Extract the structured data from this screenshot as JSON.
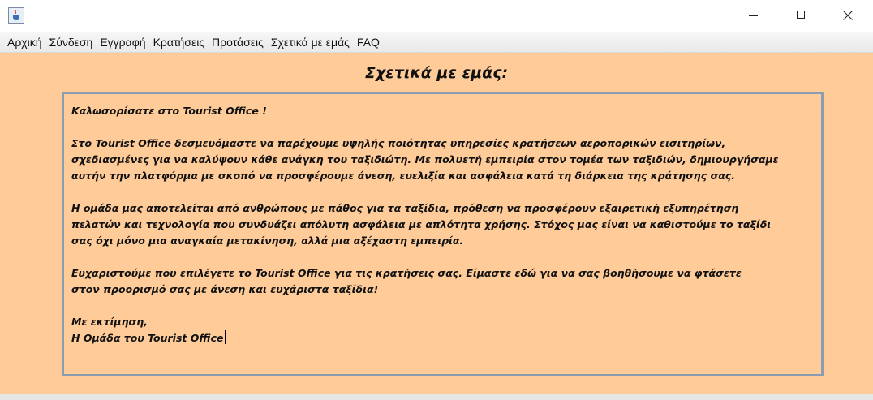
{
  "window": {
    "icon": "java-cup-icon",
    "controls": [
      "minimize-icon",
      "maximize-icon",
      "close-icon"
    ]
  },
  "menu": {
    "items": [
      "Αρχική",
      "Σύνδεση",
      "Εγγραφή",
      "Κρατήσεις",
      "Προτάσεις",
      "Σχετικά με εμάς",
      "FAQ"
    ]
  },
  "page": {
    "heading": "Σχετικά με εμάς:"
  },
  "about_text": {
    "greeting": "Καλωσορίσατε στο Tourist Office !",
    "p1": [
      "Στο Tourist Office δεσμευόμαστε να παρέχουμε υψηλής ποιότητας υπηρεσίες κρατήσεων αεροπορικών εισιτηρίων,",
      "σχεδιασμένες για να καλύψουν κάθε ανάγκη του ταξιδιώτη. Με πολυετή εμπειρία στον τομέα των ταξιδιών, δημιουργήσαμε",
      "αυτήν την πλατφόρμα με σκοπό να προσφέρουμε άνεση, ευελιξία και ασφάλεια κατά τη διάρκεια της κράτησης σας."
    ],
    "p2": [
      "Η ομάδα μας αποτελείται από ανθρώπους με πάθος για τα ταξίδια, πρόθεση να προσφέρουν εξαιρετική εξυπηρέτηση",
      "πελατών και τεχνολογία που συνδυάζει απόλυτη ασφάλεια με απλότητα χρήσης. Στόχος μας είναι να καθιστούμε το ταξίδι",
      "σας όχι μόνο μια αναγκαία μετακίνηση, αλλά μια αξέχαστη εμπειρία."
    ],
    "p3": [
      "Ευχαριστούμε που επιλέγετε το Tourist Office για τις κρατήσεις σας. Είμαστε εδώ για να σας βοηθήσουμε να φτάσετε",
      "στον προορισμό σας με άνεση και ευχάριστα ταξίδια!"
    ],
    "closing": "Με εκτίμηση,",
    "signature": "Η Ομάδα του Tourist Office"
  },
  "colors": {
    "background": "#ffcc99",
    "panel_border": "#8a9db3"
  }
}
